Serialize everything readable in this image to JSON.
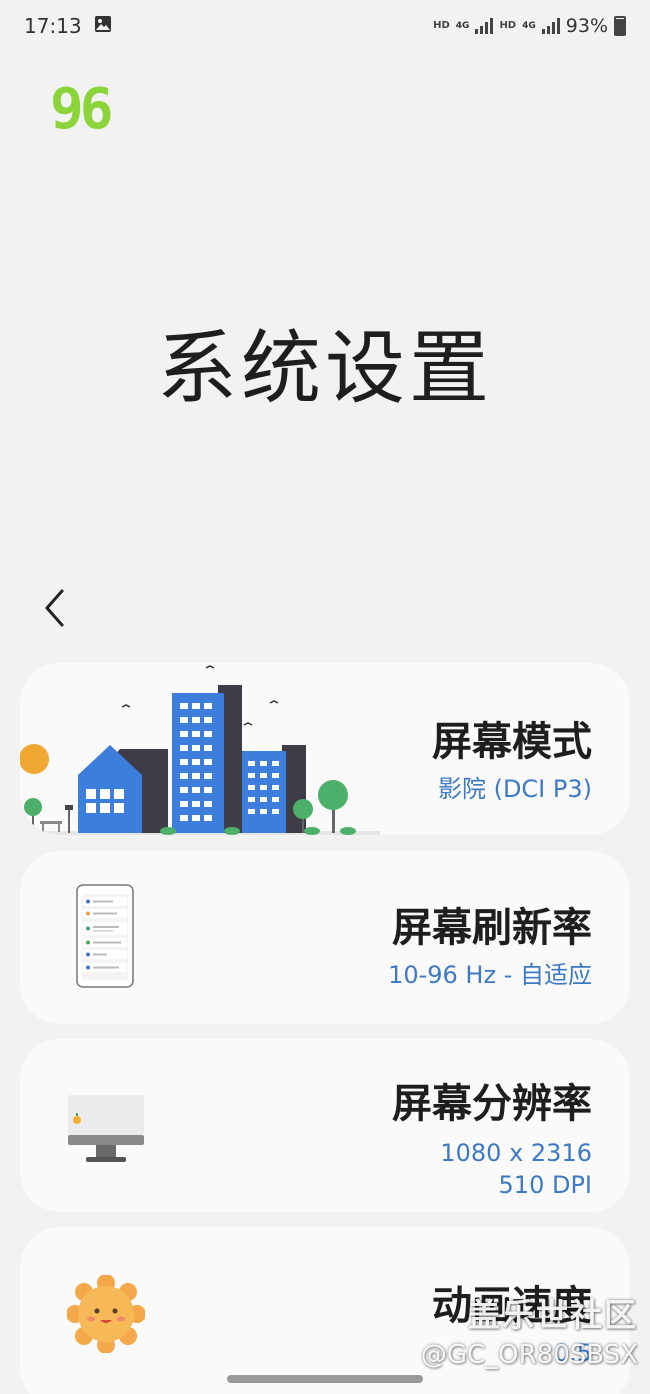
{
  "status": {
    "time": "17:13",
    "net1": "HD",
    "net1_gen": "4G",
    "net2": "HD",
    "net2_gen": "4G",
    "battery": "93%",
    "icons": [
      "image-icon",
      "signal-icon",
      "battery-icon"
    ]
  },
  "refresh_rate_overlay": "96",
  "page": {
    "title": "系统设置"
  },
  "cards": [
    {
      "title": "屏幕模式",
      "value": "影院 (DCI P3)",
      "icon": "city-illustration"
    },
    {
      "title": "屏幕刷新率",
      "value": "10-96 Hz - 自适应",
      "icon": "phone-illustration"
    },
    {
      "title": "屏幕分辨率",
      "value": "1080 x 2316",
      "value2": "510 DPI",
      "icon": "monitor-illustration"
    },
    {
      "title": "动画速度",
      "value": "0.5",
      "icon": "sun-illustration"
    }
  ],
  "watermark": {
    "line1": "盖乐世社区",
    "line2": "@GC_OR80SBSX"
  },
  "colors": {
    "accent_blue": "#3d79c4",
    "badge_green": "#8bd43a",
    "background": "#f2f2f2",
    "card": "#fafafa"
  }
}
